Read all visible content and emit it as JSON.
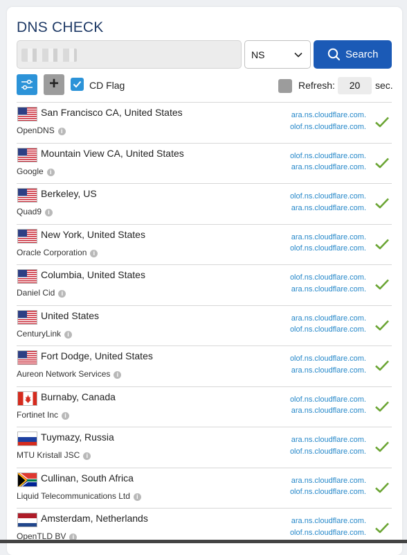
{
  "app": {
    "title": "DNS CHECK"
  },
  "search": {
    "domain_value": "",
    "record_type": "NS",
    "button_label": "Search"
  },
  "options": {
    "cd_flag_label": "CD Flag",
    "cd_flag_checked": true,
    "refresh_label": "Refresh:",
    "refresh_value": "20",
    "refresh_unit": "sec."
  },
  "colors": {
    "title": "#1f3a66",
    "primary_button": "#1b5ab6",
    "accent": "#2c93d8",
    "ns_link": "#2487c9",
    "check": "#6ba534"
  },
  "results": [
    {
      "flag": "us",
      "location": "San Francisco CA, United States",
      "provider": "OpenDNS",
      "ns": [
        "ara.ns.cloudflare.com.",
        "olof.ns.cloudflare.com."
      ],
      "status": "check-icon"
    },
    {
      "flag": "us",
      "location": "Mountain View CA, United States",
      "provider": "Google",
      "ns": [
        "olof.ns.cloudflare.com.",
        "ara.ns.cloudflare.com."
      ],
      "status": "check-icon"
    },
    {
      "flag": "us",
      "location": "Berkeley, US",
      "provider": "Quad9",
      "ns": [
        "olof.ns.cloudflare.com.",
        "ara.ns.cloudflare.com."
      ],
      "status": "check-icon"
    },
    {
      "flag": "us",
      "location": "New York, United States",
      "provider": "Oracle Corporation",
      "ns": [
        "ara.ns.cloudflare.com.",
        "olof.ns.cloudflare.com."
      ],
      "status": "check-icon"
    },
    {
      "flag": "us",
      "location": "Columbia, United States",
      "provider": "Daniel Cid",
      "ns": [
        "olof.ns.cloudflare.com.",
        "ara.ns.cloudflare.com."
      ],
      "status": "check-icon"
    },
    {
      "flag": "us",
      "location": "United States",
      "provider": "CenturyLink",
      "ns": [
        "ara.ns.cloudflare.com.",
        "olof.ns.cloudflare.com."
      ],
      "status": "check-icon"
    },
    {
      "flag": "us",
      "location": "Fort Dodge, United States",
      "provider": "Aureon Network Services",
      "ns": [
        "olof.ns.cloudflare.com.",
        "ara.ns.cloudflare.com."
      ],
      "status": "check-icon"
    },
    {
      "flag": "ca",
      "location": "Burnaby, Canada",
      "provider": "Fortinet Inc",
      "ns": [
        "olof.ns.cloudflare.com.",
        "ara.ns.cloudflare.com."
      ],
      "status": "check-icon"
    },
    {
      "flag": "ru",
      "location": "Tuymazy, Russia",
      "provider": "MTU Kristall JSC",
      "ns": [
        "ara.ns.cloudflare.com.",
        "olof.ns.cloudflare.com."
      ],
      "status": "check-icon"
    },
    {
      "flag": "za",
      "location": "Cullinan, South Africa",
      "provider": "Liquid Telecommunications Ltd",
      "ns": [
        "ara.ns.cloudflare.com.",
        "olof.ns.cloudflare.com."
      ],
      "status": "check-icon"
    },
    {
      "flag": "nl",
      "location": "Amsterdam, Netherlands",
      "provider": "OpenTLD BV",
      "ns": [
        "ara.ns.cloudflare.com.",
        "olof.ns.cloudflare.com."
      ],
      "status": "check-icon"
    }
  ]
}
